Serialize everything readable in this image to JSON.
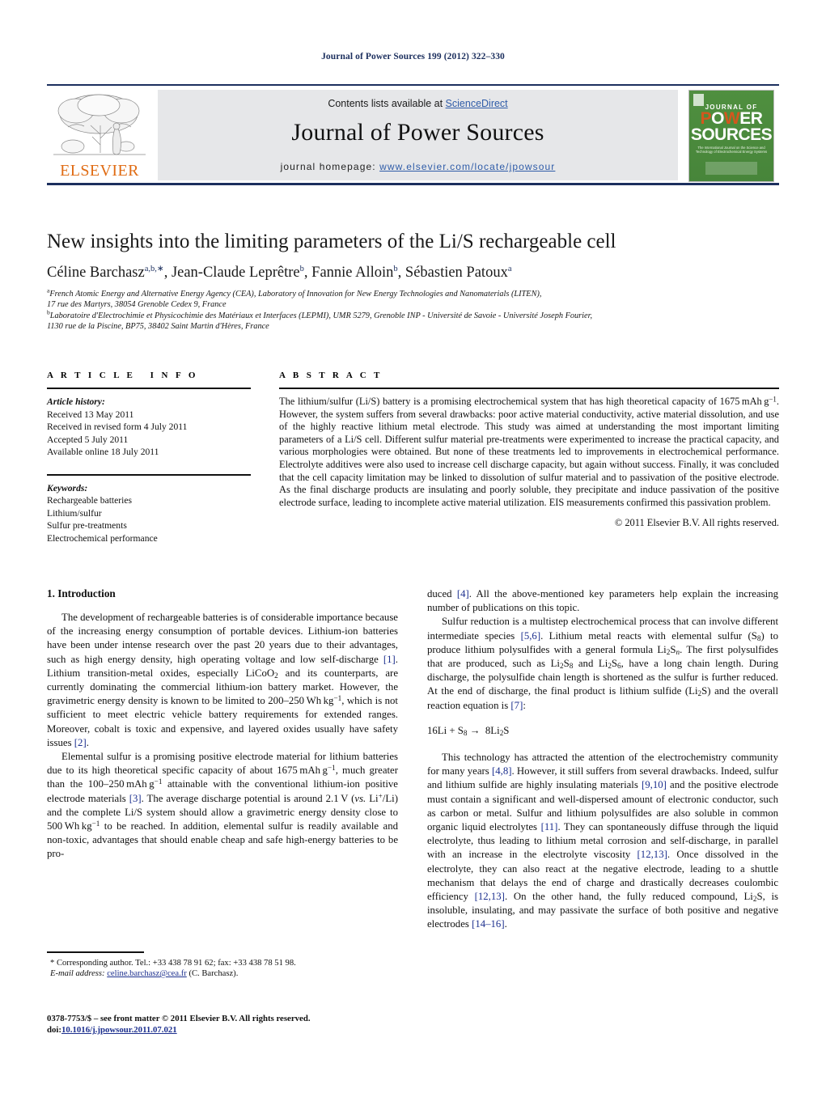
{
  "running_head": "Journal of Power Sources 199 (2012) 322–330",
  "masthead": {
    "contents_prefix": "Contents lists available at ",
    "sciencedirect": "ScienceDirect",
    "journal_name": "Journal of Power Sources",
    "homepage_prefix": "journal homepage: ",
    "homepage_url": "www.elsevier.com/locate/jpowsour",
    "publisher": "ELSEVIER",
    "publisher_color": "#e06c14",
    "band_color": "#e6e7e9",
    "rule_color": "#1c2f5e",
    "cover": {
      "line1": "JOURNAL OF",
      "line2": "POWER",
      "line3": "SOURCES",
      "subtitle": "The International Journal on the Science and Technology of Electrochemical Energy Systems",
      "bg_color": "#4a8a3c",
      "accent_color": "#d4571e"
    }
  },
  "article": {
    "title": "New insights into the limiting parameters of the Li/S rechargeable cell",
    "authors": [
      {
        "name": "Céline Barchasz",
        "marks": "a,b,∗"
      },
      {
        "name": "Jean-Claude Leprêtre",
        "marks": "b"
      },
      {
        "name": "Fannie Alloin",
        "marks": "b"
      },
      {
        "name": "Sébastien Patoux",
        "marks": "a"
      }
    ],
    "affiliations": [
      {
        "mark": "a",
        "line1": "French Atomic Energy and Alternative Energy Agency (CEA), Laboratory of Innovation for New Energy Technologies and Nanomaterials (LITEN),",
        "line2": "17 rue des Martyrs, 38054 Grenoble Cedex 9, France"
      },
      {
        "mark": "b",
        "line1": "Laboratoire d'Electrochimie et Physicochimie des Matériaux et Interfaces (LEPMI), UMR 5279, Grenoble INP - Université de Savoie - Université Joseph Fourier,",
        "line2": "1130 rue de la Piscine, BP75, 38402 Saint Martin d'Hères, France"
      }
    ]
  },
  "article_info": {
    "heading": "ARTICLE INFO",
    "history_label": "Article history:",
    "history": [
      "Received 13 May 2011",
      "Received in revised form 4 July 2011",
      "Accepted 5 July 2011",
      "Available online 18 July 2011"
    ],
    "keywords_label": "Keywords:",
    "keywords": [
      "Rechargeable batteries",
      "Lithium/sulfur",
      "Sulfur pre-treatments",
      "Electrochemical performance"
    ]
  },
  "abstract": {
    "heading": "ABSTRACT",
    "copyright": "© 2011 Elsevier B.V. All rights reserved."
  },
  "body": {
    "section1_heading": "1. Introduction",
    "equation": "16Li + S8 → 8Li2S"
  },
  "footnote": {
    "corresponding": "* Corresponding author. Tel.: +33 438 78 91 62; fax: +33 438 78 51 98.",
    "email_label": "E-mail address:",
    "email": "celine.barchasz@cea.fr",
    "email_attrib": "(C. Barchasz).",
    "issn_line": "0378-7753/$ – see front matter © 2011 Elsevier B.V. All rights reserved.",
    "doi_label": "doi:",
    "doi": "10.1016/j.jpowsour.2011.07.021"
  }
}
